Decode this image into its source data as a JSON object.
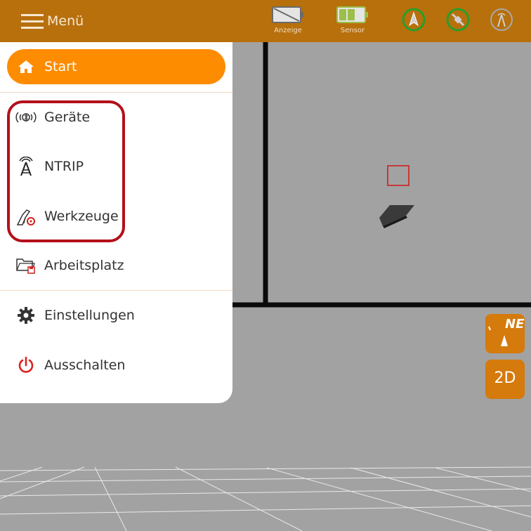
{
  "topbar": {
    "menu_label": "Menü",
    "display_caption": "Anzeige",
    "sensor_caption": "Sensor"
  },
  "menu": {
    "items": [
      {
        "label": "Start",
        "icon": "home-icon"
      },
      {
        "label": "Geräte",
        "icon": "bluetooth-signal-icon"
      },
      {
        "label": "NTRIP",
        "icon": "antenna-tower-icon"
      },
      {
        "label": "Werkzeuge",
        "icon": "excavator-tool-icon"
      },
      {
        "label": "Arbeitsplatz",
        "icon": "folder-icon"
      },
      {
        "label": "Einstellungen",
        "icon": "gear-icon"
      },
      {
        "label": "Ausschalten",
        "icon": "power-icon"
      }
    ]
  },
  "view": {
    "compass_label": "NE",
    "mode_label": "2D"
  },
  "colors": {
    "topbar": "#b7700c",
    "accent": "#fd8c00",
    "highlight_border": "#b3101b",
    "status_ok": "#2a9d2a",
    "power": "#e02020"
  }
}
